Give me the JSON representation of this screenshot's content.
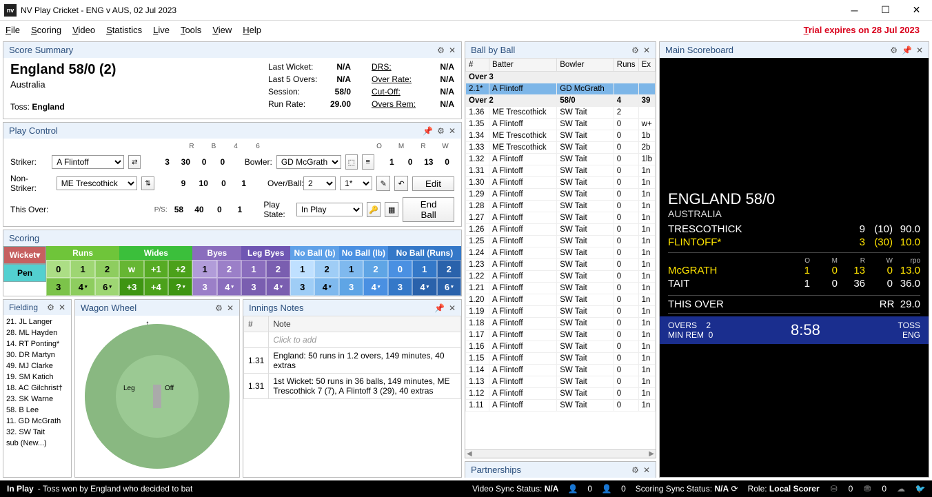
{
  "window": {
    "title": "NV Play Cricket - ENG v AUS, 02 Jul 2023",
    "logo_text": "nv"
  },
  "menu": [
    "File",
    "Scoring",
    "Video",
    "Statistics",
    "Live",
    "Tools",
    "View",
    "Help"
  ],
  "trial": "Trial expires on 28 Jul 2023",
  "score_summary": {
    "title": "Score Summary",
    "score": "England 58/0 (2)",
    "opponent": "Australia",
    "toss_label": "Toss:",
    "toss_value": "England",
    "rows_l": [
      {
        "l": "Last Wicket:",
        "v": "N/A"
      },
      {
        "l": "Last 5 Overs:",
        "v": "N/A"
      },
      {
        "l": "Session:",
        "v": "58/0"
      },
      {
        "l": "Run Rate:",
        "v": "29.00"
      }
    ],
    "rows_r": [
      {
        "l": "DRS:",
        "v": "N/A"
      },
      {
        "l": "Over Rate:",
        "v": "N/A"
      },
      {
        "l": "Cut-Off:",
        "v": "N/A"
      },
      {
        "l": "Overs Rem:",
        "v": "N/A"
      }
    ]
  },
  "play_control": {
    "title": "Play Control",
    "striker_l": "Striker:",
    "striker": "A Flintoff",
    "nonstriker_l": "Non-Striker:",
    "nonstriker": "ME Trescothick",
    "thisover_l": "This Over:",
    "ps_l": "P/S:",
    "bowler_l": "Bowler:",
    "bowler": "GD McGrath",
    "overball_l": "Over/Ball:",
    "over": "2",
    "ball": "1*",
    "playstate_l": "Play State:",
    "playstate": "In Play",
    "edit": "Edit",
    "endball": "End Ball",
    "stat_heads": [
      "R",
      "B",
      "4",
      "6"
    ],
    "striker_stats": [
      "3",
      "30",
      "0",
      "0"
    ],
    "nonstriker_stats": [
      "9",
      "10",
      "0",
      "1"
    ],
    "thisover_stats": [
      "58",
      "40",
      "0",
      "1"
    ],
    "bowl_heads": [
      "O",
      "M",
      "R",
      "W"
    ],
    "bowl_stats": [
      "1",
      "0",
      "13",
      "0"
    ]
  },
  "scoring": {
    "title": "Scoring",
    "wicket": "Wicket",
    "pen": "Pen",
    "heads": [
      "Runs",
      "Wides",
      "Byes",
      "Leg Byes",
      "No Ball (b)",
      "No Ball (lb)",
      "No Ball (Runs)"
    ],
    "row1": [
      "0",
      "1",
      "2",
      "w",
      "+1",
      "+2",
      "1",
      "2",
      "1",
      "2",
      "1",
      "2",
      "1",
      "2",
      "0",
      "1",
      "2"
    ],
    "row2": [
      "3",
      "4",
      "6",
      "+3",
      "+4",
      "?",
      "3",
      "4",
      "3",
      "4",
      "3",
      "4",
      "3",
      "4",
      "3",
      "4",
      "6"
    ]
  },
  "fielding": {
    "title": "Fielding",
    "players": [
      "21. JL Langer",
      "28. ML Hayden",
      "14. RT Ponting*",
      "30. DR Martyn",
      "49. MJ Clarke",
      "19. SM Katich",
      "18. AC Gilchrist†",
      "23. SK Warne",
      "58. B Lee",
      "11. GD McGrath",
      "32. SW Tait",
      "sub (New...)"
    ]
  },
  "wagon": {
    "title": "Wagon Wheel",
    "leg": "Leg",
    "off": "Off"
  },
  "innings": {
    "title": "Innings Notes",
    "cols": [
      "#",
      "Note"
    ],
    "placeholder": "Click to add",
    "rows": [
      {
        "n": "1.31",
        "t": "England: 50 runs in 1.2 overs, 149 minutes, 40 extras"
      },
      {
        "n": "1.31",
        "t": "1st Wicket: 50 runs in 36 balls, 149 minutes, ME Trescothick 7 (7), A Flintoff 3 (29), 40 extras"
      }
    ]
  },
  "bbb": {
    "title": "Ball by Ball",
    "cols": [
      "#",
      "Batter",
      "Bowler",
      "Runs",
      "Ex"
    ],
    "over3": "Over 3",
    "over2": "Over 2",
    "over2_score": "58/0",
    "over2_r": "4",
    "over2_e": "39",
    "current": {
      "n": "2.1*",
      "bat": "A Flintoff",
      "bowl": "GD McGrath"
    },
    "rows": [
      {
        "n": "1.36",
        "bat": "ME Trescothick",
        "bowl": "SW Tait",
        "r": "2",
        "e": ""
      },
      {
        "n": "1.35",
        "bat": "A Flintoff",
        "bowl": "SW Tait",
        "r": "0",
        "e": "w+"
      },
      {
        "n": "1.34",
        "bat": "ME Trescothick",
        "bowl": "SW Tait",
        "r": "0",
        "e": "1b"
      },
      {
        "n": "1.33",
        "bat": "ME Trescothick",
        "bowl": "SW Tait",
        "r": "0",
        "e": "2b"
      },
      {
        "n": "1.32",
        "bat": "A Flintoff",
        "bowl": "SW Tait",
        "r": "0",
        "e": "1lb"
      },
      {
        "n": "1.31",
        "bat": "A Flintoff",
        "bowl": "SW Tait",
        "r": "0",
        "e": "1n"
      },
      {
        "n": "1.30",
        "bat": "A Flintoff",
        "bowl": "SW Tait",
        "r": "0",
        "e": "1n"
      },
      {
        "n": "1.29",
        "bat": "A Flintoff",
        "bowl": "SW Tait",
        "r": "0",
        "e": "1n"
      },
      {
        "n": "1.28",
        "bat": "A Flintoff",
        "bowl": "SW Tait",
        "r": "0",
        "e": "1n"
      },
      {
        "n": "1.27",
        "bat": "A Flintoff",
        "bowl": "SW Tait",
        "r": "0",
        "e": "1n"
      },
      {
        "n": "1.26",
        "bat": "A Flintoff",
        "bowl": "SW Tait",
        "r": "0",
        "e": "1n"
      },
      {
        "n": "1.25",
        "bat": "A Flintoff",
        "bowl": "SW Tait",
        "r": "0",
        "e": "1n"
      },
      {
        "n": "1.24",
        "bat": "A Flintoff",
        "bowl": "SW Tait",
        "r": "0",
        "e": "1n"
      },
      {
        "n": "1.23",
        "bat": "A Flintoff",
        "bowl": "SW Tait",
        "r": "0",
        "e": "1n"
      },
      {
        "n": "1.22",
        "bat": "A Flintoff",
        "bowl": "SW Tait",
        "r": "0",
        "e": "1n"
      },
      {
        "n": "1.21",
        "bat": "A Flintoff",
        "bowl": "SW Tait",
        "r": "0",
        "e": "1n"
      },
      {
        "n": "1.20",
        "bat": "A Flintoff",
        "bowl": "SW Tait",
        "r": "0",
        "e": "1n"
      },
      {
        "n": "1.19",
        "bat": "A Flintoff",
        "bowl": "SW Tait",
        "r": "0",
        "e": "1n"
      },
      {
        "n": "1.18",
        "bat": "A Flintoff",
        "bowl": "SW Tait",
        "r": "0",
        "e": "1n"
      },
      {
        "n": "1.17",
        "bat": "A Flintoff",
        "bowl": "SW Tait",
        "r": "0",
        "e": "1n"
      },
      {
        "n": "1.16",
        "bat": "A Flintoff",
        "bowl": "SW Tait",
        "r": "0",
        "e": "1n"
      },
      {
        "n": "1.15",
        "bat": "A Flintoff",
        "bowl": "SW Tait",
        "r": "0",
        "e": "1n"
      },
      {
        "n": "1.14",
        "bat": "A Flintoff",
        "bowl": "SW Tait",
        "r": "0",
        "e": "1n"
      },
      {
        "n": "1.13",
        "bat": "A Flintoff",
        "bowl": "SW Tait",
        "r": "0",
        "e": "1n"
      },
      {
        "n": "1.12",
        "bat": "A Flintoff",
        "bowl": "SW Tait",
        "r": "0",
        "e": "1n"
      },
      {
        "n": "1.11",
        "bat": "A Flintoff",
        "bowl": "SW Tait",
        "r": "0",
        "e": "1n"
      }
    ]
  },
  "partnerships": {
    "title": "Partnerships"
  },
  "scoreboard": {
    "title": "Main Scoreboard",
    "team": "ENGLAND 58/0",
    "opp": "AUSTRALIA",
    "bat1": {
      "n": "TRESCOTHICK",
      "r": "9",
      "b": "(10)",
      "sr": "90.0"
    },
    "bat2": {
      "n": "FLINTOFF*",
      "r": "3",
      "b": "(30)",
      "sr": "10.0"
    },
    "bowl_heads": [
      "O",
      "M",
      "R",
      "W",
      "rpo"
    ],
    "bowl1": {
      "n": "McGRATH",
      "o": "1",
      "m": "0",
      "r": "13",
      "w": "0",
      "rpo": "13.0"
    },
    "bowl2": {
      "n": "TAIT",
      "o": "1",
      "m": "0",
      "r": "36",
      "w": "0",
      "rpo": "36.0"
    },
    "thisover_l": "THIS OVER",
    "rr_l": "RR",
    "rr": "29.0",
    "overs_l": "OVERS",
    "overs": "2",
    "minrem_l": "MIN REM",
    "minrem": "0",
    "time": "8:58",
    "toss_l": "TOSS",
    "toss": "ENG"
  },
  "status": {
    "left_l": "In Play",
    "left_t": " - Toss won by England who decided to bat",
    "video": "Video Sync Status:",
    "video_v": "N/A",
    "scoring": "Scoring Sync Status:",
    "scoring_v": "N/A",
    "role": "Role:",
    "role_v": "Local Scorer"
  }
}
